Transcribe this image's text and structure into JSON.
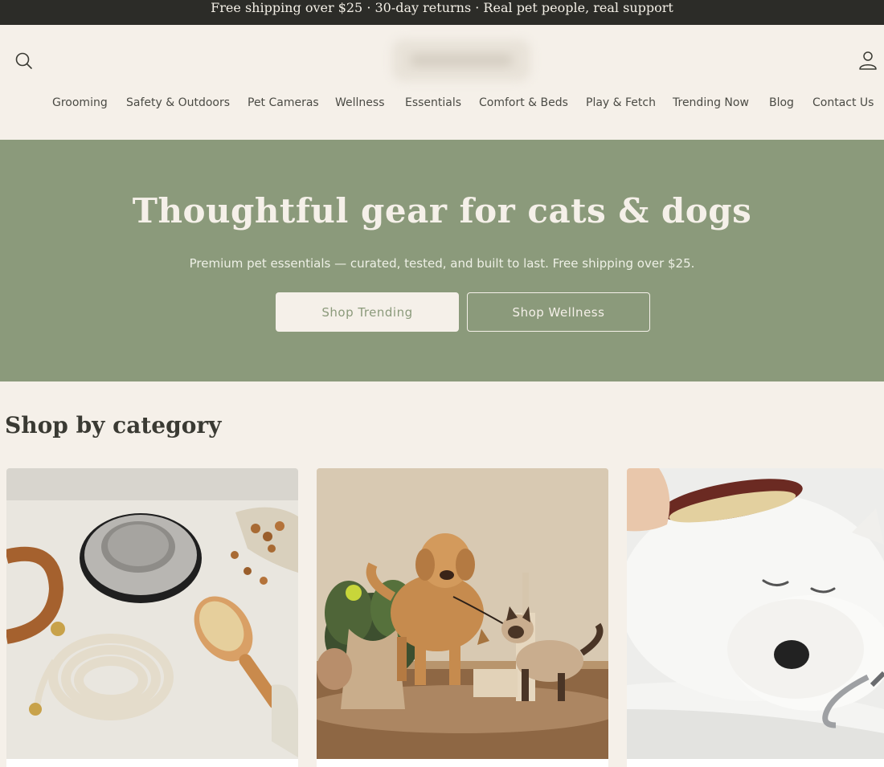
{
  "announcement": "Free shipping over $25 · 30-day returns · Real pet people, real support",
  "header": {
    "search_icon": "search-icon",
    "account_icon": "user-icon"
  },
  "nav": [
    "Grooming",
    "Safety & Outdoors",
    "Pet Cameras",
    "Wellness",
    "Essentials",
    "Comfort & Beds",
    "Play & Fetch",
    "Trending Now",
    "Blog",
    "Contact Us"
  ],
  "hero": {
    "title": "Thoughtful gear for cats & dogs",
    "subtitle": "Premium pet essentials — curated, tested, and built to last. Free shipping over $25.",
    "primary_button": "Shop Trending",
    "secondary_button": "Shop Wellness"
  },
  "categories_section": {
    "title": "Shop by category"
  },
  "colors": {
    "hero_bg": "#8b9a7b",
    "page_bg": "#f5f0e9",
    "bar_bg": "#2c2c28"
  }
}
